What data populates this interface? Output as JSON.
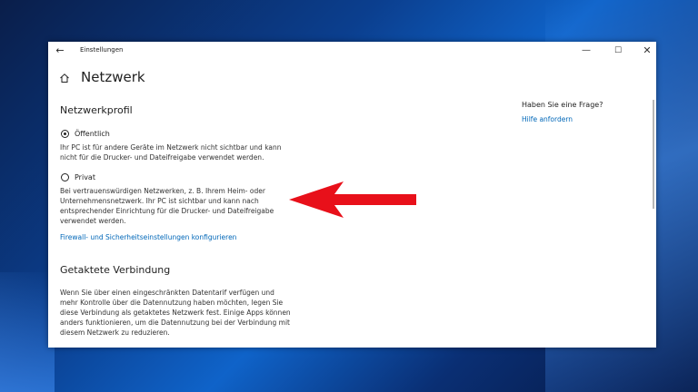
{
  "window": {
    "title": "Einstellungen",
    "controls": {
      "minimize": "—",
      "maximize": "☐",
      "close": "✕"
    }
  },
  "page": {
    "title": "Netzwerk"
  },
  "network_profile": {
    "heading": "Netzwerkprofil",
    "options": [
      {
        "label": "Öffentlich",
        "checked": true,
        "description": "Ihr PC ist für andere Geräte im Netzwerk nicht sichtbar und kann nicht für die Drucker- und Dateifreigabe verwendet werden."
      },
      {
        "label": "Privat",
        "checked": false,
        "description": "Bei vertrauenswürdigen Netzwerken, z. B. Ihrem Heim- oder Unternehmensnetzwerk. Ihr PC ist sichtbar und kann nach entsprechender Einrichtung für die Drucker- und Dateifreigabe verwendet werden."
      }
    ],
    "firewall_link": "Firewall- und Sicherheitseinstellungen konfigurieren"
  },
  "metered": {
    "heading": "Getaktete Verbindung",
    "description": "Wenn Sie über einen eingeschränkten Datentarif verfügen und mehr Kontrolle über die Datennutzung haben möchten, legen Sie diese Verbindung als getaktetes Netzwerk fest. Einige Apps können anders funktionieren, um die Datennutzung bei der Verbindung mit diesem Netzwerk zu reduzieren."
  },
  "help": {
    "question": "Haben Sie eine Frage?",
    "link": "Hilfe anfordern"
  },
  "colors": {
    "accent_link": "#0067b8",
    "annotation_arrow": "#e8101a"
  },
  "icons": {
    "back": "back-arrow-icon",
    "home": "home-icon",
    "annotation": "red-arrow-icon"
  }
}
